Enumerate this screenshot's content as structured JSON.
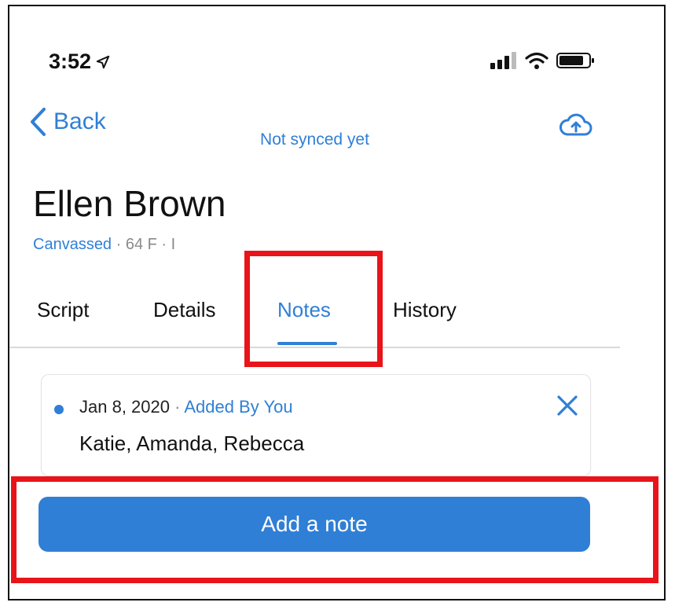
{
  "status_bar": {
    "time": "3:52",
    "icons": [
      "location-arrow-icon",
      "signal-bars-icon",
      "wifi-icon",
      "battery-icon"
    ]
  },
  "nav": {
    "back_label": "Back",
    "sync_status": "Not synced yet",
    "upload_icon": "cloud-upload-icon"
  },
  "contact": {
    "name": "Ellen Brown",
    "status": "Canvassed",
    "details": " · 64  F · I"
  },
  "tabs": [
    {
      "label": "Script",
      "active": false
    },
    {
      "label": "Details",
      "active": false
    },
    {
      "label": "Notes",
      "active": true
    },
    {
      "label": "History",
      "active": false
    }
  ],
  "notes": [
    {
      "date": "Jan 8, 2020",
      "separator": " · ",
      "author": "Added By You",
      "text": "Katie, Amanda, Rebecca"
    }
  ],
  "actions": {
    "add_note_label": "Add a note"
  },
  "colors": {
    "accent": "#2f7fd6",
    "highlight": "#e8141a",
    "text": "#111111",
    "muted": "#8a8a8a"
  }
}
